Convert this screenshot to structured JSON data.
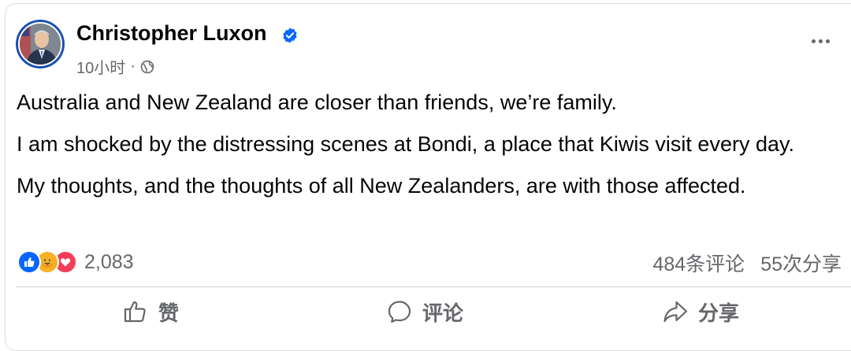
{
  "post": {
    "author": "Christopher Luxon",
    "timestamp": "10小时",
    "separator": "·",
    "privacy_icon": "globe-icon",
    "verified_icon": "verified-badge-icon",
    "more_icon": "more-options-icon",
    "paragraphs": [
      "Australia and New Zealand are closer than friends, we’re family.",
      "I am shocked by the distressing scenes at Bondi, a place that Kiwis visit every day.",
      "My thoughts, and the thoughts of all New Zealanders, are with those affected."
    ]
  },
  "reactions": {
    "icons": [
      "like-reaction-icon",
      "care-reaction-icon",
      "love-reaction-icon"
    ],
    "count": "2,083",
    "comments": "484条评论",
    "shares": "55次分享"
  },
  "actions": {
    "like": "赞",
    "comment": "评论",
    "share": "分享"
  },
  "colors": {
    "accent": "#0866ff",
    "muted_text": "#65676b",
    "love": "#f33e58",
    "care": "#f7b125"
  }
}
